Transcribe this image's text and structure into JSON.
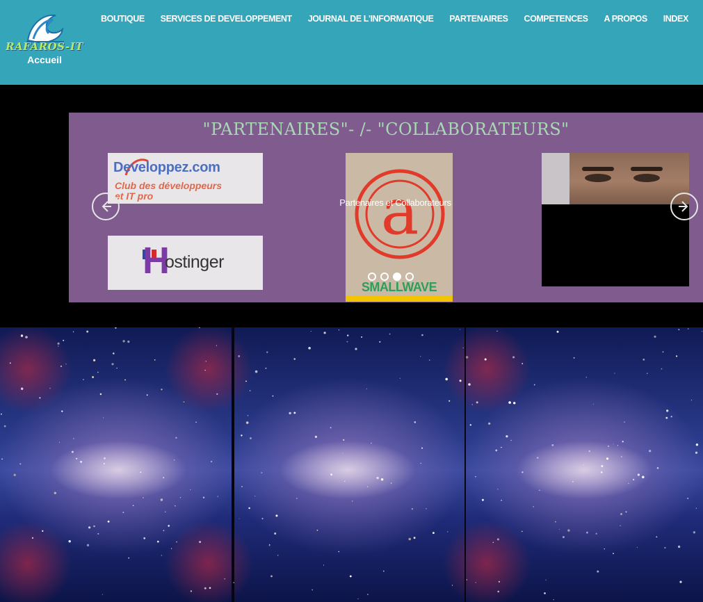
{
  "brand": {
    "logo_text": "RAFAROS-IT",
    "home_label": "Accueil"
  },
  "nav": {
    "items": [
      "BOUTIQUE",
      "SERVICES DE DEVELOPPEMENT",
      "JOURNAL DE L'INFORMATIQUE",
      "PARTENAIRES",
      "COMPETENCES",
      "A PROPOS",
      "INDEX"
    ]
  },
  "carousel": {
    "title": "\"PARTENAIRES\"- /- \"COLLABORATEURS\"",
    "caption": "Partenaires et Collaborateurs",
    "active_slide_index": 2,
    "slide_count": 4,
    "partners": {
      "developpez": {
        "brand": "Developpez.com",
        "tagline_1": "Club des développeurs",
        "tagline_2": "et IT pro"
      },
      "hostinger": {
        "initial": "H",
        "rest": "ostinger"
      },
      "smallwave": {
        "text": "SMALLWAVE"
      }
    }
  },
  "colors": {
    "header_bg": "#35a6ba",
    "carousel_bg": "#7f5b8e",
    "title_color": "#a8d8b4",
    "page_bg": "#000000"
  },
  "icons": {
    "prev": "arrow-left-circle-icon",
    "next": "arrow-right-circle-icon",
    "logo": "wave-icon"
  }
}
